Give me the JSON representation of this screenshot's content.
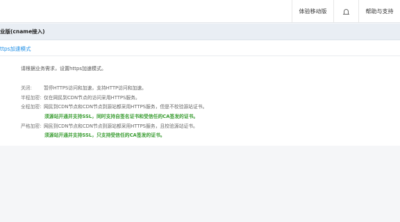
{
  "topbar": {
    "mobile_label": "体验移动版",
    "bell_icon": "bell-icon",
    "help_label": "帮助与支持"
  },
  "section": {
    "title": "业版(cname接入)"
  },
  "tab": {
    "active_label": "ttps加速模式"
  },
  "content": {
    "description": "请根据业务需求，设置https加速模式。",
    "modes": [
      {
        "label": "关闭:",
        "text": "暂停HTTPS访问和加速，支持HTTP访问和加速。",
        "note": ""
      },
      {
        "label": "半程加密:",
        "text": "仅在网民到CDN节点的访问采用HTTPS服务。",
        "note": ""
      },
      {
        "label": "全程加密:",
        "text": "网民到CDN节点和CDN节点到源站都采用HTTPS服务，但是不校验源站证书。",
        "note": "须源站开通并支持SSL，同时支持自签名证书和受信任的CA签发的证书。"
      },
      {
        "label": "严格加密:",
        "text": "网民到CDN节点和CDN节点到源站都采用HTTPS服务，且校验源站证书。",
        "note": "须源站开通并支持SSL，只支持受信任的CA签发的证书。"
      }
    ]
  },
  "colors": {
    "link_blue": "#1e8ee6",
    "note_green": "#3a9d32",
    "header_bg": "#e9eef4",
    "page_bg": "#f5f6f8"
  }
}
